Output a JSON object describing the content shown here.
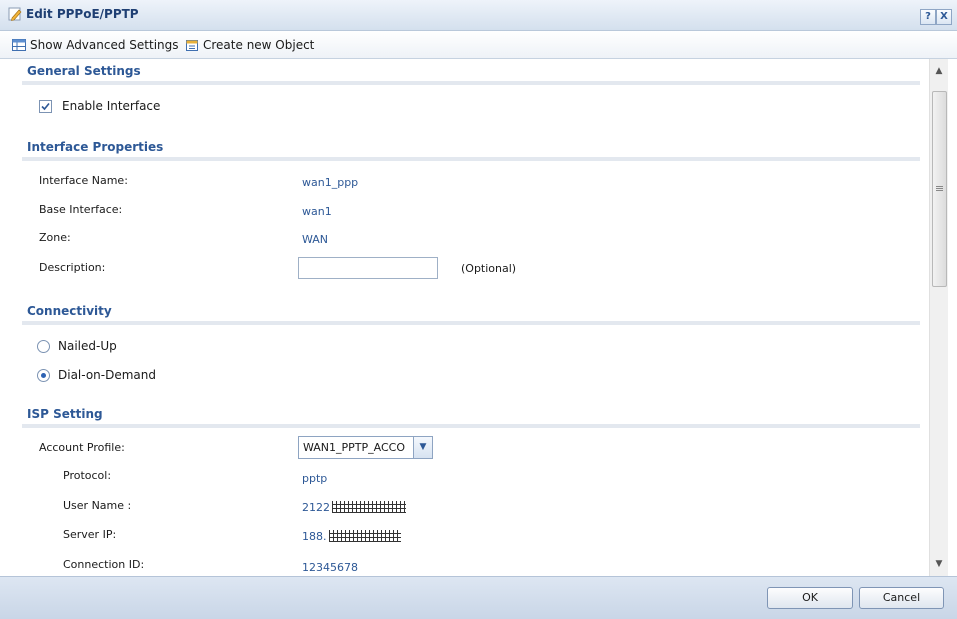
{
  "window": {
    "title": "Edit PPPoE/PPTP",
    "help_label": "?",
    "close_label": "X"
  },
  "toolbar": {
    "advanced_label": "Show Advanced Settings",
    "create_label": "Create new Object"
  },
  "general": {
    "heading": "General Settings",
    "enable_label": "Enable Interface",
    "enable_checked": true
  },
  "properties": {
    "heading": "Interface Properties",
    "name_label": "Interface Name:",
    "name_value": "wan1_ppp",
    "base_label": "Base Interface:",
    "base_value": "wan1",
    "zone_label": "Zone:",
    "zone_value": "WAN",
    "description_label": "Description:",
    "description_value": "",
    "description_hint": "(Optional)"
  },
  "connectivity": {
    "heading": "Connectivity",
    "nailed_label": "Nailed-Up",
    "nailed_selected": false,
    "dial_label": "Dial-on-Demand",
    "dial_selected": true
  },
  "isp": {
    "heading": "ISP Setting",
    "profile_label": "Account Profile:",
    "profile_value": "WAN1_PPTP_ACCO",
    "protocol_label": "Protocol:",
    "protocol_value": "pptp",
    "user_label": "User Name :",
    "user_value": "2122",
    "server_label": "Server IP:",
    "server_value": "188.",
    "conn_label": "Connection ID:",
    "conn_value": "12345678"
  },
  "footer": {
    "ok_label": "OK",
    "cancel_label": "Cancel"
  },
  "colors": {
    "accent": "#2d5896",
    "title_bar": "#d4e0ee",
    "footer": "#c9d6e7"
  }
}
